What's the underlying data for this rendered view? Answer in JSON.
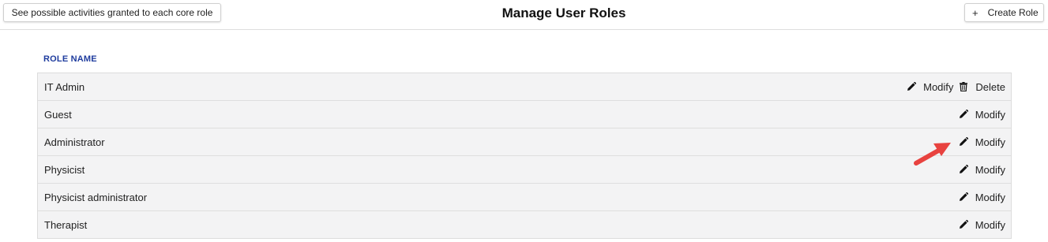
{
  "header": {
    "activities_button_label": "See possible activities granted to each core role",
    "title": "Manage User Roles",
    "create_button_plus": "+",
    "create_button_label": "Create Role"
  },
  "table": {
    "column_header": "ROLE NAME",
    "modify_label": "Modify",
    "delete_label": "Delete",
    "rows": [
      {
        "name": "IT Admin",
        "actions": [
          "modify",
          "delete"
        ]
      },
      {
        "name": "Guest",
        "actions": [
          "modify"
        ]
      },
      {
        "name": "Administrator",
        "actions": [
          "modify"
        ]
      },
      {
        "name": "Physicist",
        "actions": [
          "modify"
        ]
      },
      {
        "name": "Physicist administrator",
        "actions": [
          "modify"
        ]
      },
      {
        "name": "Therapist",
        "actions": [
          "modify"
        ]
      }
    ]
  },
  "icons": {
    "modify": "pencil-icon",
    "delete": "trash-icon",
    "annotation": "red-arrow-annotation"
  },
  "colors": {
    "column_header": "#1f3c9e",
    "row_background": "#f3f3f4",
    "annotation_arrow": "#e8423f"
  }
}
